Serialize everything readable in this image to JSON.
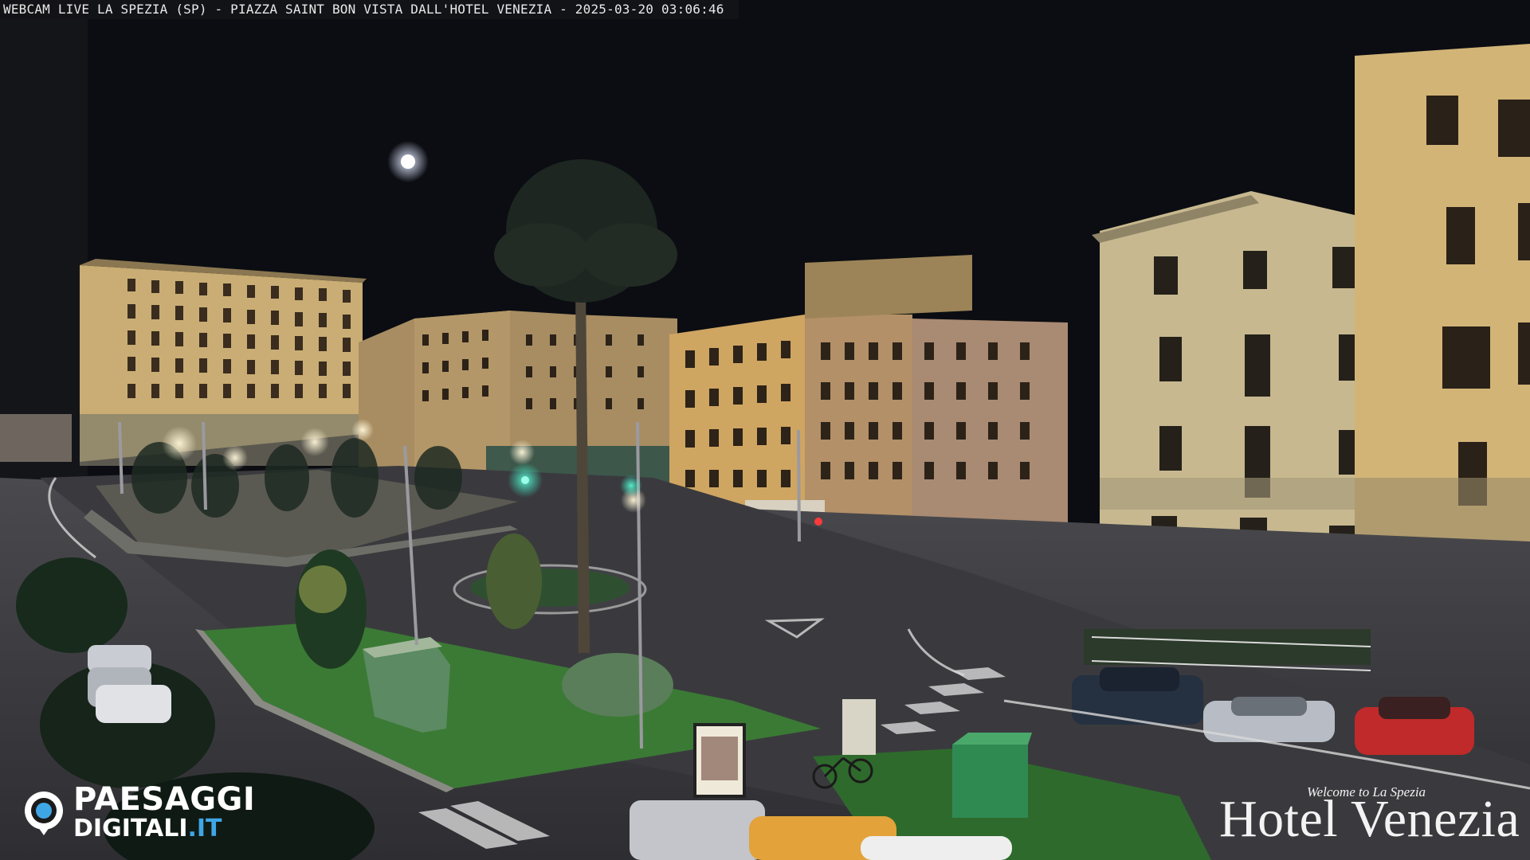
{
  "overlay": {
    "caption": "WEBCAM LIVE LA SPEZIA (SP) - PIAZZA SAINT BON VISTA DALL'HOTEL VENEZIA - 2025-03-20 03:06:46"
  },
  "branding": {
    "left_logo_top": "PAESAGGI",
    "left_logo_bottom": "DIGITALI",
    "left_logo_suffix": ".IT",
    "right_logo_welcome": "Welcome  to  La Spezia",
    "right_logo_name": "Hotel Venezia"
  },
  "colors": {
    "sky": "#0b0d12",
    "facade_warm": "#c9a970",
    "facade_cream": "#cbbd94",
    "asphalt": "#3c3c40",
    "grass": "#3b7a35",
    "traffic_light": "#38f0c8",
    "brand_blue": "#3fa6e6"
  },
  "icons": {
    "moon": "moon-icon",
    "logo_mark": "camera-eye-icon"
  }
}
